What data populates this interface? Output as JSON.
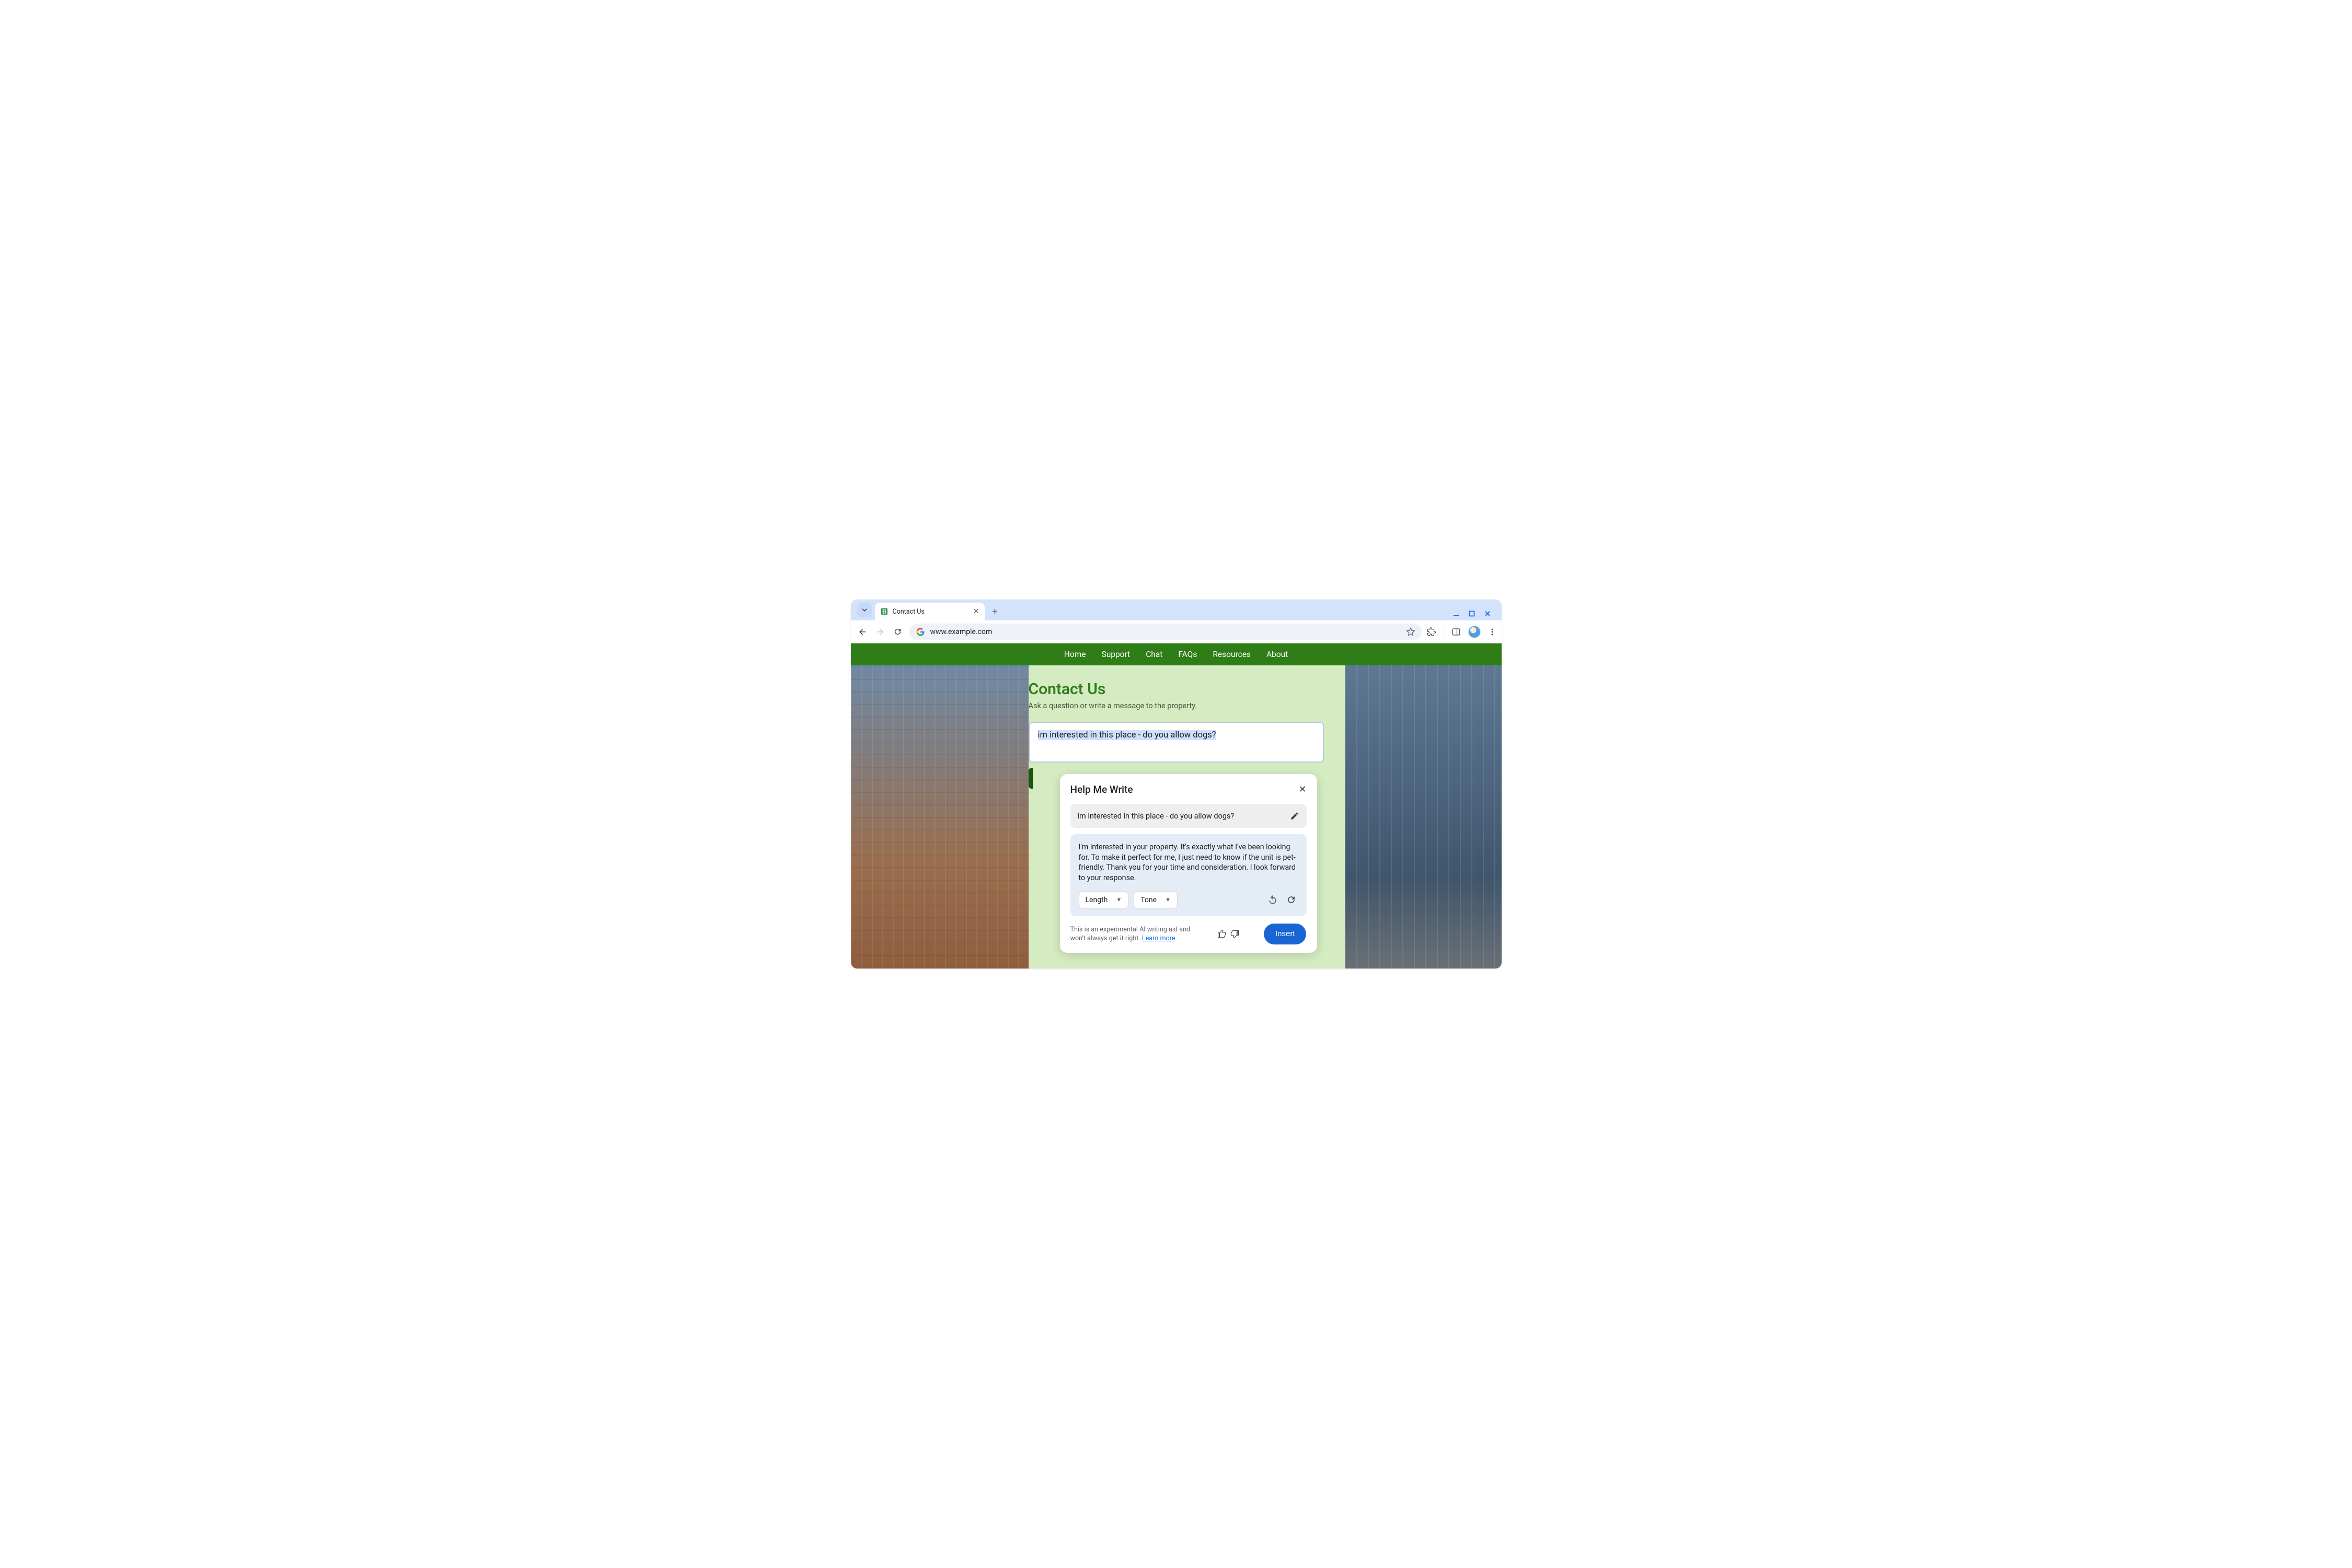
{
  "browser": {
    "tab_title": "Contact Us",
    "url": "www.example.com"
  },
  "nav": {
    "items": [
      "Home",
      "Support",
      "Chat",
      "FAQs",
      "Resources",
      "About"
    ]
  },
  "page": {
    "title": "Contact Us",
    "subtitle": "Ask a question or write a message to the property.",
    "textarea_value": "im interested in this place - do you allow dogs?"
  },
  "popup": {
    "title": "Help Me Write",
    "prompt_text": "im interested in this place - do you allow dogs?",
    "suggestion": "I'm interested in your property. It's exactly what I've been looking for. To make it perfect for me, I just need to know if the unit is pet-friendly. Thank you for your time and consideration. I look forward to your response.",
    "chip_length": "Length",
    "chip_tone": "Tone",
    "disclaimer_text": "This is an experimental AI writing aid and won't always get it right. ",
    "learn_more": "Learn more",
    "insert_label": "Insert"
  }
}
